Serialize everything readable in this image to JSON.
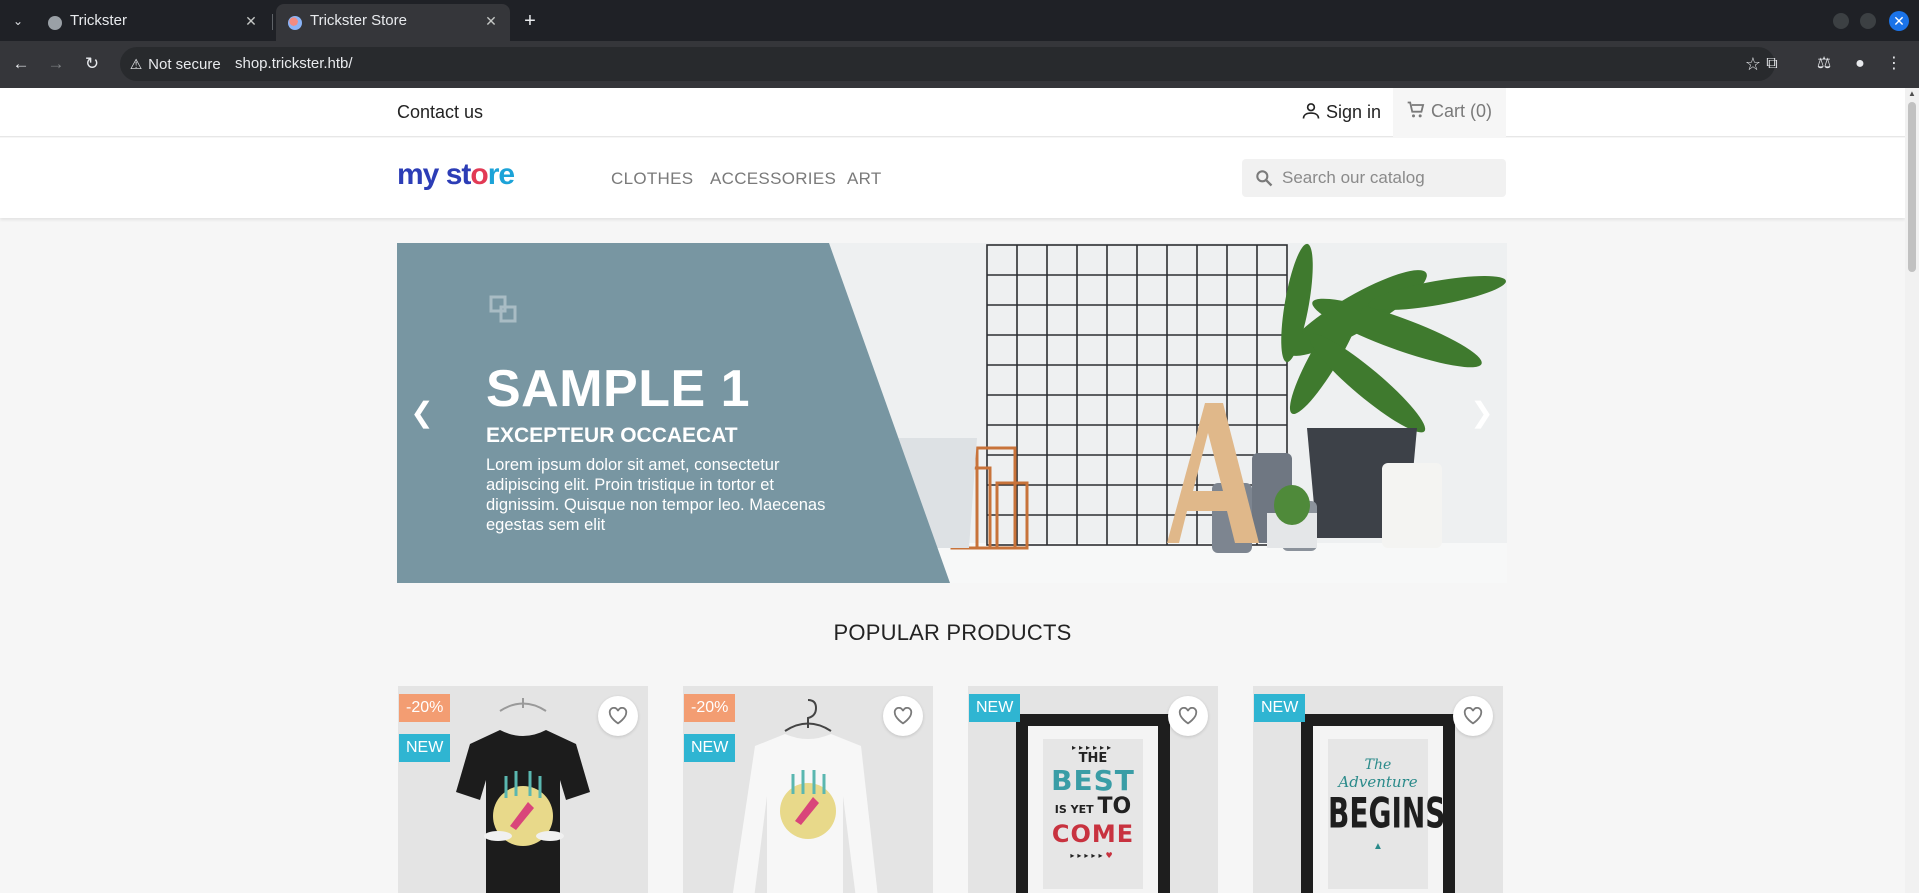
{
  "browser": {
    "tabs": [
      {
        "title": "Trickster",
        "active": false
      },
      {
        "title": "Trickster Store",
        "active": true
      }
    ],
    "security_label": "Not secure",
    "url": "shop.trickster.htb/"
  },
  "header": {
    "contact": "Contact us",
    "signin": "Sign in",
    "cart": "Cart (0)",
    "logo": {
      "part1": "my",
      "part2": "st",
      "part3": "o",
      "part4": "re"
    },
    "menu": [
      "CLOTHES",
      "ACCESSORIES",
      "ART"
    ],
    "search_placeholder": "Search our catalog"
  },
  "carousel": {
    "title": "SAMPLE 1",
    "subtitle": "EXCEPTEUR OCCAECAT",
    "description": "Lorem ipsum dolor sit amet, consectetur adipiscing elit. Proin tristique in tortor et dignissim. Quisque non tempor leo. Maecenas egestas sem elit"
  },
  "popular_title": "POPULAR PRODUCTS",
  "products": [
    {
      "flags": [
        "-20%",
        "NEW"
      ],
      "art": "black-tshirt"
    },
    {
      "flags": [
        "-20%",
        "NEW"
      ],
      "art": "white-sweater"
    },
    {
      "flags": [
        "NEW"
      ],
      "art": "poster-best-is-yet-to-come"
    },
    {
      "flags": [
        "NEW"
      ],
      "art": "poster-adventure-begins"
    }
  ],
  "poster1": {
    "line1": "THE",
    "line2": "BEST",
    "line3": "IS YET",
    "line4": "TO",
    "line5": "COME"
  },
  "poster2": {
    "line1": "The",
    "line2": "Adventure",
    "line3": "BEGINS"
  },
  "colors": {
    "accent": "#2fb5d2",
    "discount": "#f39d72",
    "slide_panel": "#7896a2"
  }
}
